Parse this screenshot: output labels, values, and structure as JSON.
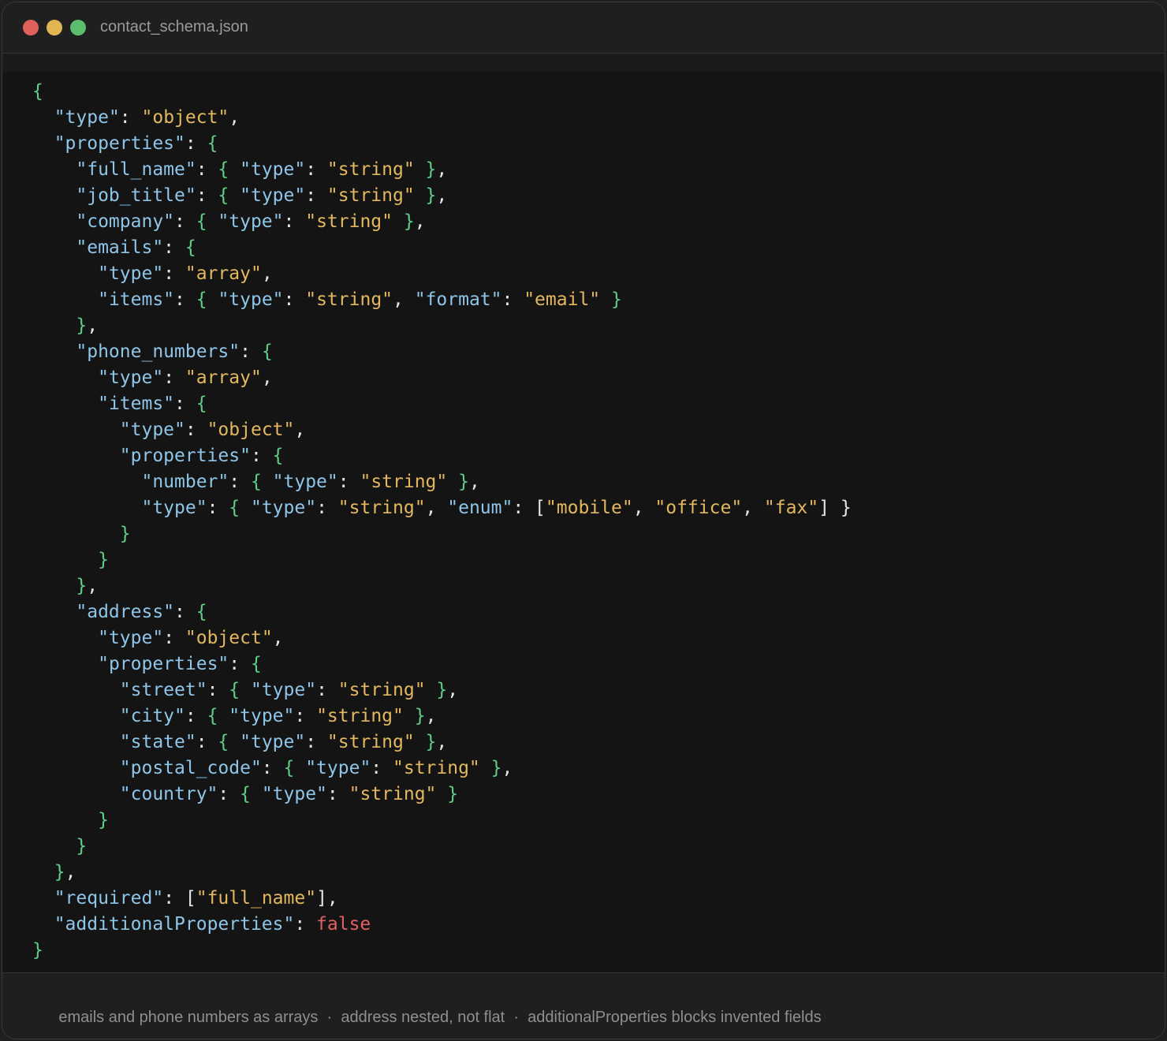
{
  "window": {
    "title": "contact_schema.json"
  },
  "code_lines": [
    [
      [
        "b",
        "{"
      ]
    ],
    [
      [
        "p",
        "  "
      ],
      [
        "k",
        "\"type\""
      ],
      [
        "p",
        ": "
      ],
      [
        "s",
        "\"object\""
      ],
      [
        "p",
        ","
      ]
    ],
    [
      [
        "p",
        "  "
      ],
      [
        "k",
        "\"properties\""
      ],
      [
        "p",
        ": "
      ],
      [
        "b",
        "{"
      ]
    ],
    [
      [
        "p",
        "    "
      ],
      [
        "k",
        "\"full_name\""
      ],
      [
        "p",
        ": "
      ],
      [
        "b",
        "{ "
      ],
      [
        "k",
        "\"type\""
      ],
      [
        "p",
        ": "
      ],
      [
        "s",
        "\"string\""
      ],
      [
        "b",
        " }"
      ],
      [
        "p",
        ","
      ]
    ],
    [
      [
        "p",
        "    "
      ],
      [
        "k",
        "\"job_title\""
      ],
      [
        "p",
        ": "
      ],
      [
        "b",
        "{ "
      ],
      [
        "k",
        "\"type\""
      ],
      [
        "p",
        ": "
      ],
      [
        "s",
        "\"string\""
      ],
      [
        "b",
        " }"
      ],
      [
        "p",
        ","
      ]
    ],
    [
      [
        "p",
        "    "
      ],
      [
        "k",
        "\"company\""
      ],
      [
        "p",
        ": "
      ],
      [
        "b",
        "{ "
      ],
      [
        "k",
        "\"type\""
      ],
      [
        "p",
        ": "
      ],
      [
        "s",
        "\"string\""
      ],
      [
        "b",
        " }"
      ],
      [
        "p",
        ","
      ]
    ],
    [
      [
        "p",
        "    "
      ],
      [
        "k",
        "\"emails\""
      ],
      [
        "p",
        ": "
      ],
      [
        "b",
        "{"
      ]
    ],
    [
      [
        "p",
        "      "
      ],
      [
        "k",
        "\"type\""
      ],
      [
        "p",
        ": "
      ],
      [
        "s",
        "\"array\""
      ],
      [
        "p",
        ","
      ]
    ],
    [
      [
        "p",
        "      "
      ],
      [
        "k",
        "\"items\""
      ],
      [
        "p",
        ": "
      ],
      [
        "b",
        "{ "
      ],
      [
        "k",
        "\"type\""
      ],
      [
        "p",
        ": "
      ],
      [
        "s",
        "\"string\""
      ],
      [
        "p",
        ", "
      ],
      [
        "k",
        "\"format\""
      ],
      [
        "p",
        ": "
      ],
      [
        "s",
        "\"email\""
      ],
      [
        "b",
        " }"
      ]
    ],
    [
      [
        "p",
        "    "
      ],
      [
        "b",
        "}"
      ],
      [
        "p",
        ","
      ]
    ],
    [
      [
        "p",
        "    "
      ],
      [
        "k",
        "\"phone_numbers\""
      ],
      [
        "p",
        ": "
      ],
      [
        "b",
        "{"
      ]
    ],
    [
      [
        "p",
        "      "
      ],
      [
        "k",
        "\"type\""
      ],
      [
        "p",
        ": "
      ],
      [
        "s",
        "\"array\""
      ],
      [
        "p",
        ","
      ]
    ],
    [
      [
        "p",
        "      "
      ],
      [
        "k",
        "\"items\""
      ],
      [
        "p",
        ": "
      ],
      [
        "b",
        "{"
      ]
    ],
    [
      [
        "p",
        "        "
      ],
      [
        "k",
        "\"type\""
      ],
      [
        "p",
        ": "
      ],
      [
        "s",
        "\"object\""
      ],
      [
        "p",
        ","
      ]
    ],
    [
      [
        "p",
        "        "
      ],
      [
        "k",
        "\"properties\""
      ],
      [
        "p",
        ": "
      ],
      [
        "b",
        "{"
      ]
    ],
    [
      [
        "p",
        "          "
      ],
      [
        "k",
        "\"number\""
      ],
      [
        "p",
        ": "
      ],
      [
        "b",
        "{ "
      ],
      [
        "k",
        "\"type\""
      ],
      [
        "p",
        ": "
      ],
      [
        "s",
        "\"string\""
      ],
      [
        "b",
        " }"
      ],
      [
        "p",
        ","
      ]
    ],
    [
      [
        "p",
        "          "
      ],
      [
        "k",
        "\"type\""
      ],
      [
        "p",
        ": "
      ],
      [
        "b",
        "{ "
      ],
      [
        "k",
        "\"type\""
      ],
      [
        "p",
        ": "
      ],
      [
        "s",
        "\"string\""
      ],
      [
        "p",
        ", "
      ],
      [
        "k",
        "\"enum\""
      ],
      [
        "p",
        ": ["
      ],
      [
        "s",
        "\"mobile\""
      ],
      [
        "p",
        ", "
      ],
      [
        "s",
        "\"office\""
      ],
      [
        "p",
        ", "
      ],
      [
        "s",
        "\"fax\""
      ],
      [
        "p",
        "] }"
      ]
    ],
    [
      [
        "p",
        "        "
      ],
      [
        "b",
        "}"
      ]
    ],
    [
      [
        "p",
        "      "
      ],
      [
        "b",
        "}"
      ]
    ],
    [
      [
        "p",
        "    "
      ],
      [
        "b",
        "}"
      ],
      [
        "p",
        ","
      ]
    ],
    [
      [
        "p",
        "    "
      ],
      [
        "k",
        "\"address\""
      ],
      [
        "p",
        ": "
      ],
      [
        "b",
        "{"
      ]
    ],
    [
      [
        "p",
        "      "
      ],
      [
        "k",
        "\"type\""
      ],
      [
        "p",
        ": "
      ],
      [
        "s",
        "\"object\""
      ],
      [
        "p",
        ","
      ]
    ],
    [
      [
        "p",
        "      "
      ],
      [
        "k",
        "\"properties\""
      ],
      [
        "p",
        ": "
      ],
      [
        "b",
        "{"
      ]
    ],
    [
      [
        "p",
        "        "
      ],
      [
        "k",
        "\"street\""
      ],
      [
        "p",
        ": "
      ],
      [
        "b",
        "{ "
      ],
      [
        "k",
        "\"type\""
      ],
      [
        "p",
        ": "
      ],
      [
        "s",
        "\"string\""
      ],
      [
        "b",
        " }"
      ],
      [
        "p",
        ","
      ]
    ],
    [
      [
        "p",
        "        "
      ],
      [
        "k",
        "\"city\""
      ],
      [
        "p",
        ": "
      ],
      [
        "b",
        "{ "
      ],
      [
        "k",
        "\"type\""
      ],
      [
        "p",
        ": "
      ],
      [
        "s",
        "\"string\""
      ],
      [
        "b",
        " }"
      ],
      [
        "p",
        ","
      ]
    ],
    [
      [
        "p",
        "        "
      ],
      [
        "k",
        "\"state\""
      ],
      [
        "p",
        ": "
      ],
      [
        "b",
        "{ "
      ],
      [
        "k",
        "\"type\""
      ],
      [
        "p",
        ": "
      ],
      [
        "s",
        "\"string\""
      ],
      [
        "b",
        " }"
      ],
      [
        "p",
        ","
      ]
    ],
    [
      [
        "p",
        "        "
      ],
      [
        "k",
        "\"postal_code\""
      ],
      [
        "p",
        ": "
      ],
      [
        "b",
        "{ "
      ],
      [
        "k",
        "\"type\""
      ],
      [
        "p",
        ": "
      ],
      [
        "s",
        "\"string\""
      ],
      [
        "b",
        " }"
      ],
      [
        "p",
        ","
      ]
    ],
    [
      [
        "p",
        "        "
      ],
      [
        "k",
        "\"country\""
      ],
      [
        "p",
        ": "
      ],
      [
        "b",
        "{ "
      ],
      [
        "k",
        "\"type\""
      ],
      [
        "p",
        ": "
      ],
      [
        "s",
        "\"string\""
      ],
      [
        "b",
        " }"
      ]
    ],
    [
      [
        "p",
        "      "
      ],
      [
        "b",
        "}"
      ]
    ],
    [
      [
        "p",
        "    "
      ],
      [
        "b",
        "}"
      ]
    ],
    [
      [
        "p",
        "  "
      ],
      [
        "b",
        "}"
      ],
      [
        "p",
        ","
      ]
    ],
    [
      [
        "p",
        "  "
      ],
      [
        "k",
        "\"required\""
      ],
      [
        "p",
        ": ["
      ],
      [
        "s",
        "\"full_name\""
      ],
      [
        "p",
        "],"
      ]
    ],
    [
      [
        "p",
        "  "
      ],
      [
        "k",
        "\"additionalProperties\""
      ],
      [
        "p",
        ": "
      ],
      [
        "f",
        "false"
      ]
    ],
    [
      [
        "b",
        "}"
      ]
    ]
  ],
  "footer": {
    "notes": [
      "emails and phone numbers as arrays",
      "address nested, not flat",
      "additionalProperties blocks invented fields"
    ],
    "separator": "·"
  }
}
